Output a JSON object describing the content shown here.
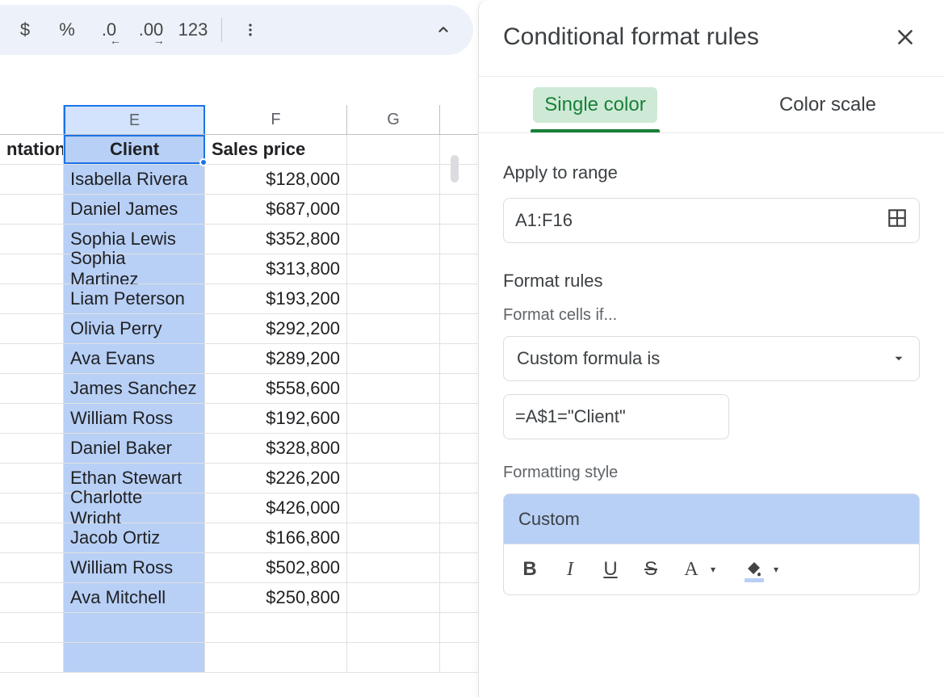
{
  "toolbar": {
    "currency": "$",
    "percent": "%",
    "dec_decrease": ".0",
    "dec_increase": ".00",
    "num_format": "123"
  },
  "sheet": {
    "col_stub_partial": "ntation",
    "columns": {
      "E": "E",
      "F": "F",
      "G": "G"
    },
    "header": {
      "E": "Client",
      "F": "Sales price"
    },
    "rows": [
      {
        "E": "Isabella Rivera",
        "F": "$128,000"
      },
      {
        "E": "Daniel James",
        "F": "$687,000"
      },
      {
        "E": "Sophia Lewis",
        "F": "$352,800"
      },
      {
        "E": "Sophia Martinez",
        "F": "$313,800"
      },
      {
        "E": "Liam Peterson",
        "F": "$193,200"
      },
      {
        "E": "Olivia Perry",
        "F": "$292,200"
      },
      {
        "E": "Ava Evans",
        "F": "$289,200"
      },
      {
        "E": "James Sanchez",
        "F": "$558,600"
      },
      {
        "E": "William Ross",
        "F": "$192,600"
      },
      {
        "E": "Daniel Baker",
        "F": "$328,800"
      },
      {
        "E": "Ethan Stewart",
        "F": "$226,200"
      },
      {
        "E": "Charlotte Wright",
        "F": "$426,000"
      },
      {
        "E": "Jacob Ortiz",
        "F": "$166,800"
      },
      {
        "E": "William Ross",
        "F": "$502,800"
      },
      {
        "E": "Ava Mitchell",
        "F": "$250,800"
      },
      {
        "E": "",
        "F": ""
      },
      {
        "E": "",
        "F": ""
      }
    ]
  },
  "panel": {
    "title": "Conditional format rules",
    "tab_single": "Single color",
    "tab_scale": "Color scale",
    "apply_label": "Apply to range",
    "range_value": "A1:F16",
    "format_rules_label": "Format rules",
    "format_if_label": "Format cells if...",
    "condition_select": "Custom formula is",
    "formula_value": "=A$1=\"Client\"",
    "style_label": "Formatting style",
    "style_name": "Custom"
  }
}
